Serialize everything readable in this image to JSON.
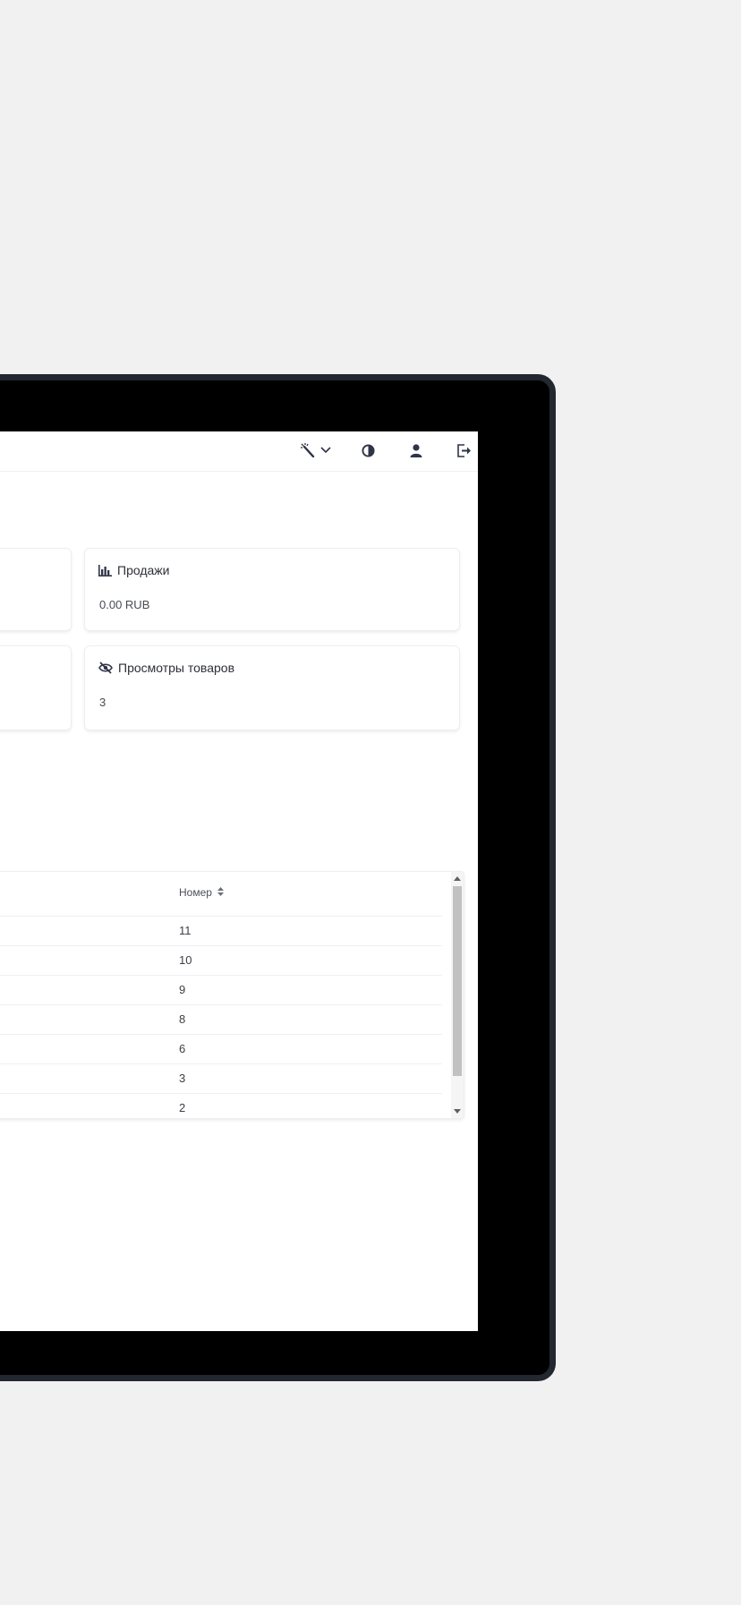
{
  "topbar": {
    "icons": [
      "magic-wand-icon",
      "chevron-down-icon",
      "contrast-icon",
      "user-icon",
      "logout-icon"
    ]
  },
  "cards": [
    {
      "icon": "bar-chart-icon",
      "title": "Продажи",
      "value": "0.00 RUB"
    },
    {
      "icon": "eye-slash-icon",
      "title": "Просмотры товаров",
      "value": "3"
    }
  ],
  "table": {
    "column_header": "Номер",
    "rows": [
      "11",
      "10",
      "9",
      "8",
      "6",
      "3",
      "2"
    ]
  },
  "colors": {
    "background": "#f1f1f2",
    "device_frame": "#23272f",
    "icon": "#2f3447"
  }
}
